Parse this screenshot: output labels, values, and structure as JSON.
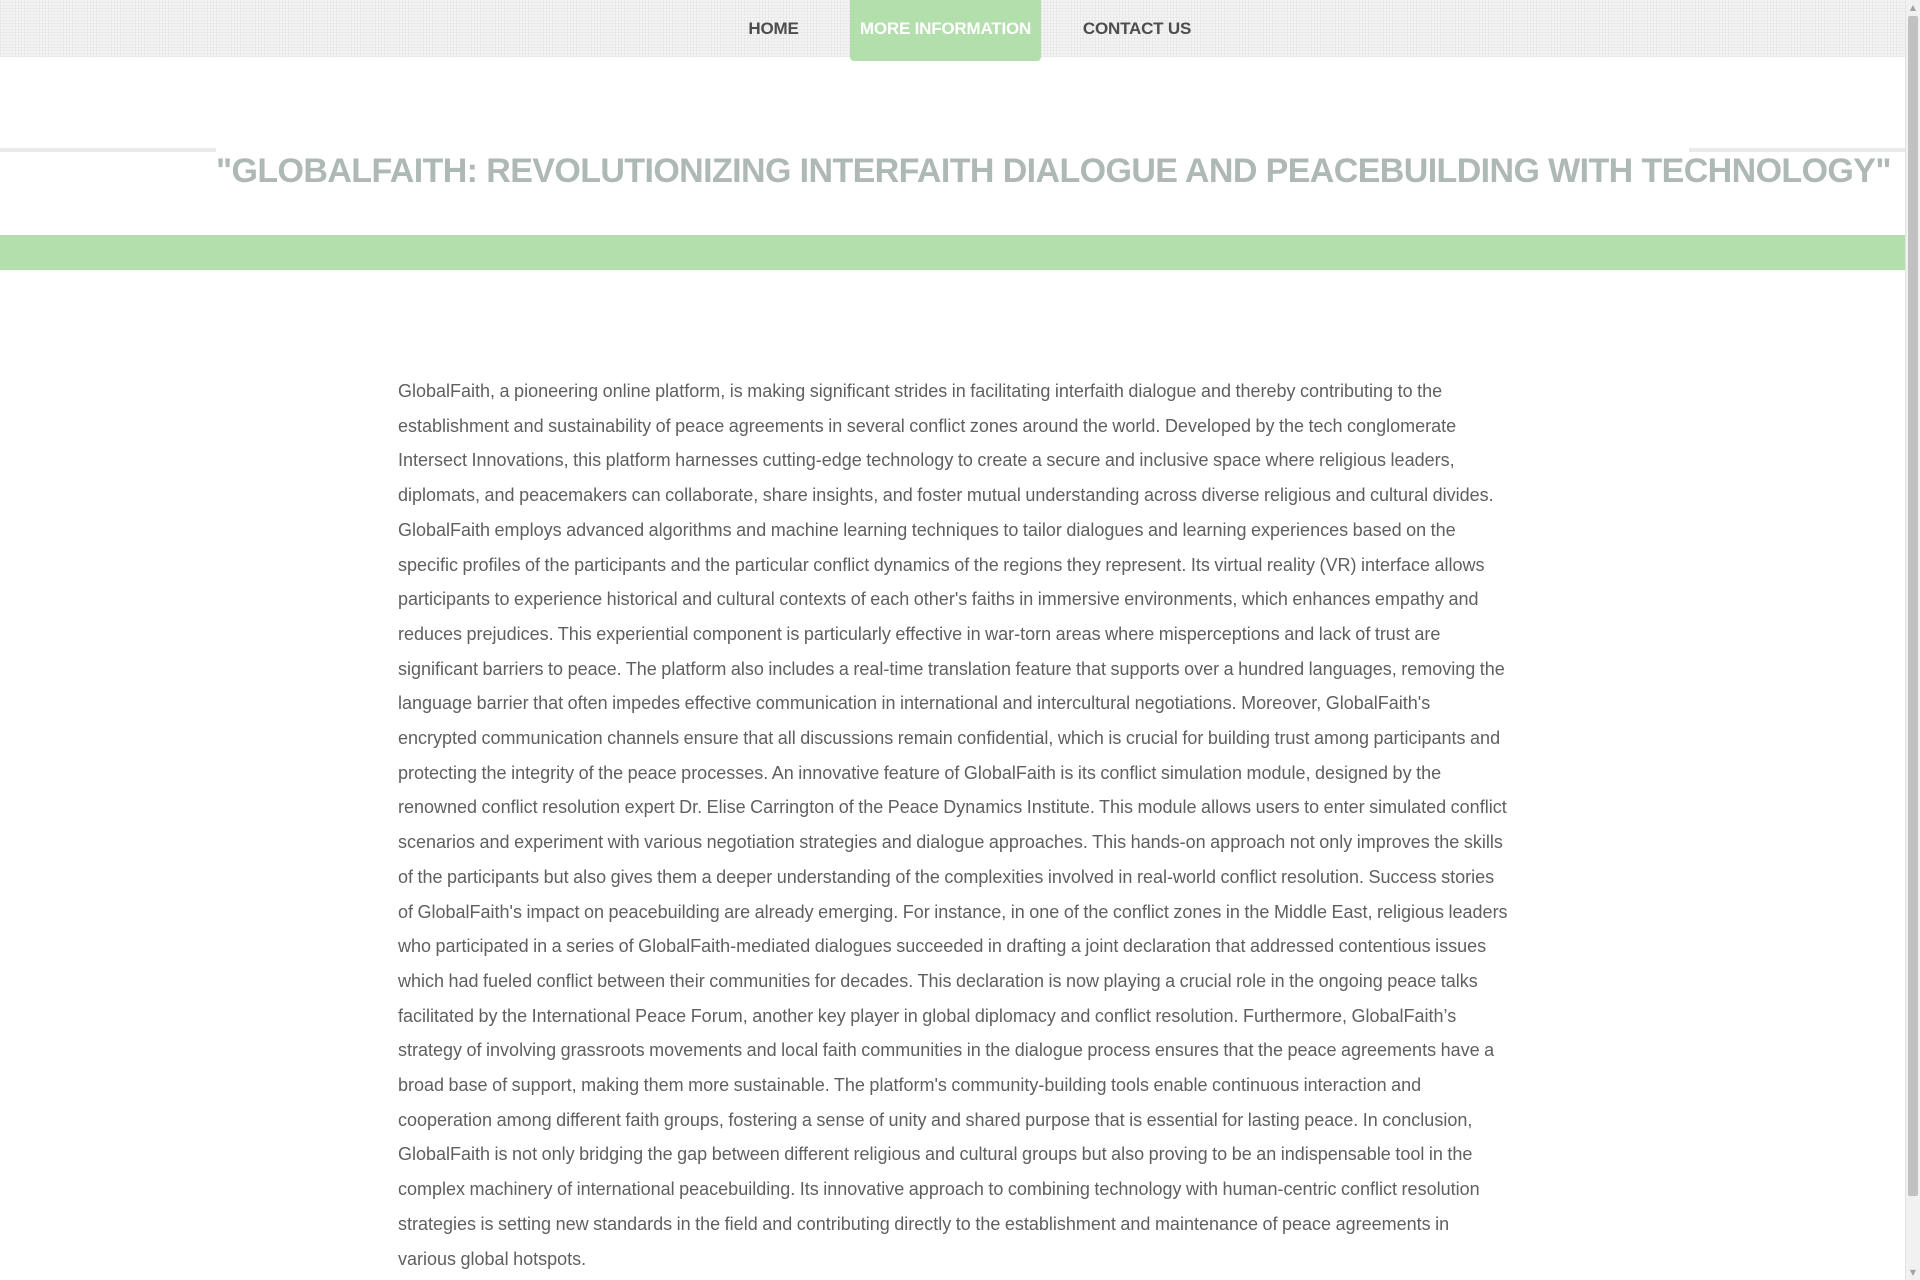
{
  "nav": {
    "items": [
      {
        "label": "HOME"
      },
      {
        "label": "MORE INFORMATION",
        "active": true
      },
      {
        "label": "CONTACT US"
      }
    ]
  },
  "article": {
    "title": "\"GLOBALFAITH: REVOLUTIONIZING INTERFAITH DIALOGUE AND PEACEBUILDING WITH TECHNOLOGY\"",
    "body": "GlobalFaith, a pioneering online platform, is making significant strides in facilitating interfaith dialogue and thereby contributing to the establishment and sustainability of peace agreements in several conflict zones around the world. Developed by the tech conglomerate Intersect Innovations, this platform harnesses cutting-edge technology to create a secure and inclusive space where religious leaders, diplomats, and peacemakers can collaborate, share insights, and foster mutual understanding across diverse religious and cultural divides. GlobalFaith employs advanced algorithms and machine learning techniques to tailor dialogues and learning experiences based on the specific profiles of the participants and the particular conflict dynamics of the regions they represent. Its virtual reality (VR) interface allows participants to experience historical and cultural contexts of each other's faiths in immersive environments, which enhances empathy and reduces prejudices. This experiential component is particularly effective in war-torn areas where misperceptions and lack of trust are significant barriers to peace. The platform also includes a real-time translation feature that supports over a hundred languages, removing the language barrier that often impedes effective communication in international and intercultural negotiations. Moreover, GlobalFaith's encrypted communication channels ensure that all discussions remain confidential, which is crucial for building trust among participants and protecting the integrity of the peace processes. An innovative feature of GlobalFaith is its conflict simulation module, designed by the renowned conflict resolution expert Dr. Elise Carrington of the Peace Dynamics Institute. This module allows users to enter simulated conflict scenarios and experiment with various negotiation strategies and dialogue approaches. This hands-on approach not only improves the skills of the participants but also gives them a deeper understanding of the complexities involved in real-world conflict resolution. Success stories of GlobalFaith's impact on peacebuilding are already emerging. For instance, in one of the conflict zones in the Middle East, religious leaders who participated in a series of GlobalFaith-mediated dialogues succeeded in drafting a joint declaration that addressed contentious issues which had fueled conflict between their communities for decades. This declaration is now playing a crucial role in the ongoing peace talks facilitated by the International Peace Forum, another key player in global diplomacy and conflict resolution. Furthermore, GlobalFaith’s strategy of involving grassroots movements and local faith communities in the dialogue process ensures that the peace agreements have a broad base of support, making them more sustainable. The platform's community-building tools enable continuous interaction and cooperation among different faith groups, fostering a sense of unity and shared purpose that is essential for lasting peace. In conclusion, GlobalFaith is not only bridging the gap between different religious and cultural groups but also proving to be an indispensable tool in the complex machinery of international peacebuilding. Its innovative approach to combining technology with human-centric conflict resolution strategies is setting new standards in the field and contributing directly to the establishment and maintenance of peace agreements in various global hotspots."
  },
  "colors": {
    "accent_green": "#b3dfad",
    "title_gray": "#aeb8b4",
    "body_text": "#606060",
    "nav_text": "#4d4d4d"
  },
  "scrollbar": {
    "up_icon": "triangle-up",
    "down_icon": "triangle-down"
  }
}
